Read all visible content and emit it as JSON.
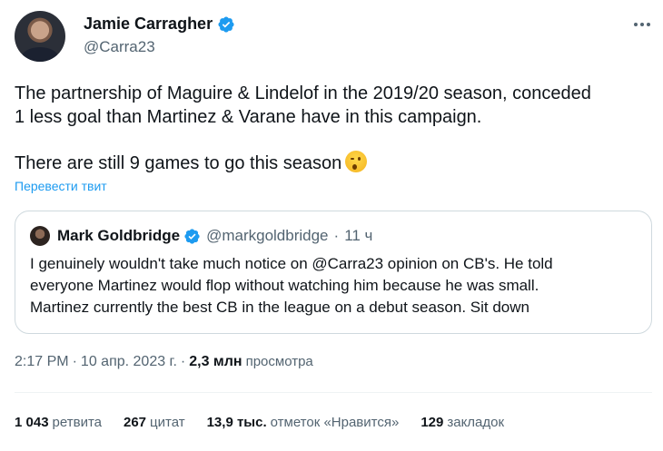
{
  "author": {
    "name": "Jamie Carragher",
    "handle": "@Carra23"
  },
  "tweet": {
    "line1": "The partnership of Maguire & Lindelof in the 2019/20 season, conceded",
    "line2": "1 less goal than Martinez & Varane have in this campaign.",
    "line3": "There are still 9 games to go this season",
    "emoji": "winking-face",
    "translate_label": "Перевести твит"
  },
  "quote": {
    "name": "Mark Goldbridge",
    "handle": "@markgoldbridge",
    "dot": "·",
    "time": "11 ч",
    "line1": "I genuinely wouldn't take much notice on @Carra23 opinion on CB's. He told",
    "line2": "everyone Martinez would flop without watching him because he was small.",
    "line3": "Martinez currently the best CB in the league on a debut season. Sit down"
  },
  "meta": {
    "time": "2:17 PM",
    "sep1": "·",
    "date": "10 апр. 2023 г.",
    "sep2": "·",
    "views_count": "2,3 млн",
    "views_label": "просмотра"
  },
  "stats": [
    {
      "num": "1 043",
      "label": "ретвита"
    },
    {
      "num": "267",
      "label": "цитат"
    },
    {
      "num": "13,9 тыс.",
      "label": "отметок «Нравится»"
    },
    {
      "num": "129",
      "label": "закладок"
    }
  ],
  "colors": {
    "accent": "#1d9bf0",
    "secondary_text": "#536471",
    "border": "#cfd9de"
  }
}
